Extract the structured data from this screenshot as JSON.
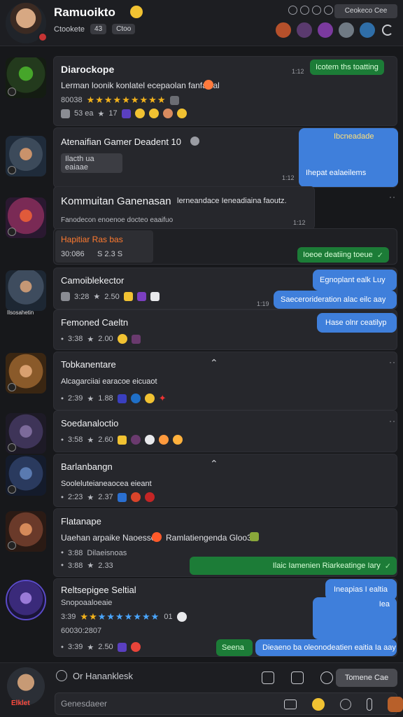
{
  "header": {
    "title": "Ramuoikto",
    "subtitle": "Ctookete",
    "chip": "43",
    "chip2": "Ctoo",
    "button": "Ceokeco Cee"
  },
  "feed": [
    {
      "title": "Diarockope",
      "text": "Lerman loonik konlatel ecepaolan fanfaitial",
      "meta1": "80038",
      "meta2": "53 ea",
      "meta3": "17",
      "reply": "Icotem ths toatting",
      "time": "1:12"
    },
    {
      "title": "Atenaifian Gamer Deadent 10",
      "tag": "Ilacth  ua eaiaae",
      "bubble_top": "Ibcneadade",
      "bubble_text": "Ihepat ealaeilems",
      "time": "1:12"
    },
    {
      "title": "Kommuitan Ganenasan",
      "title_rest": "lerneandace Ieneadiaina faoutz.",
      "text": "Fanodecon enoenoe docteo eaaifuo",
      "tag": "Hapitiar Ras bas",
      "meta1": "30:086",
      "meta2": "S 2.3 S",
      "reply": "Ioeoe deatiing toeue",
      "time": "1:12"
    },
    {
      "title": "Camoiblekector",
      "meta1": "3:28",
      "meta2": "2.50",
      "bubble1": "Egnoplant ealk Luy",
      "bubble2": "Saecerorideration alac eilc aay",
      "label": "Ilsosahetin",
      "time": "1:19"
    },
    {
      "title": "Femoned Caeltn",
      "meta1": "3:38",
      "meta2": "2.00",
      "bubble": "Hase olnr ceatilyp"
    },
    {
      "title": "Tobkanentare",
      "text": "Alcagarciiai earacoe eicuaot",
      "meta1": "2:39",
      "meta2": "1.88"
    },
    {
      "title": "Soedanaloctio",
      "meta1": "3:58",
      "meta2": "2.60"
    },
    {
      "title": "Barlanbangn",
      "text": "Sooleluteianeaocea eieant",
      "meta1": "2:23",
      "meta2": "2.37"
    },
    {
      "title": "Flatanape",
      "text": "Uaehan arpaike Naoesson",
      "text_rest": "Ramlatiengenda Gloo3",
      "meta1": "3:88",
      "meta2": "Dilaeisnoas",
      "meta3": "2.33",
      "reply": "Ilaic Iamenien Riarkeatinge Iary"
    },
    {
      "title": "Reltsepigee Seltial",
      "sub": "Snopoaaloeaie",
      "meta1": "3:39",
      "meta2": "01",
      "meta3": "60030:2807",
      "meta4": "3:39",
      "meta5": "2.50",
      "bubble1": "Ineapias I ealtia",
      "bubble2": "Iea",
      "bubble3": "Dieaeno ba oleonodeatien eaitia Ia aay",
      "reply": "Seena"
    }
  ],
  "bottom": {
    "label": "Or Hananklesk",
    "me": "Elklet",
    "button": "Tomene Cae",
    "placeholder": "Genesdaeer"
  }
}
